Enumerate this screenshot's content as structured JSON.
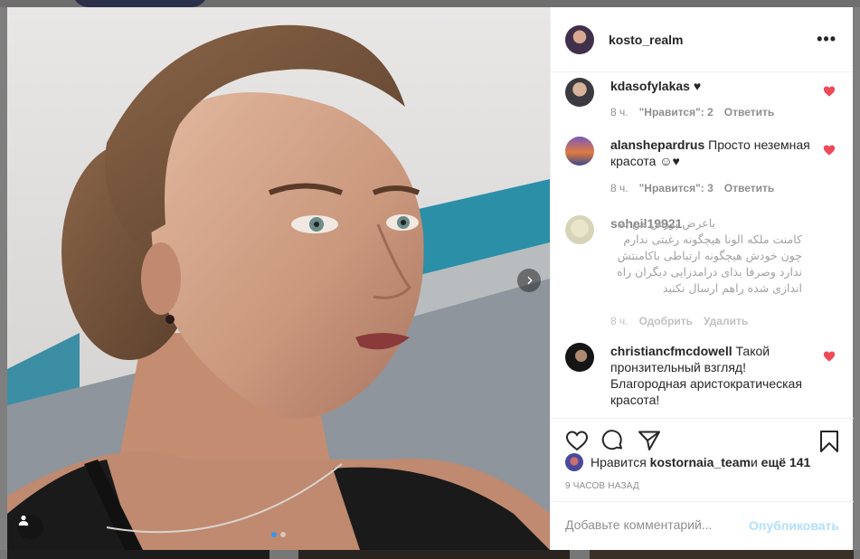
{
  "post": {
    "author": "kosto_realm",
    "more_icon": "more-horizontal-icon",
    "carousel_next_icon": "chevron-right-icon",
    "user_tag_icon": "user-tag-icon"
  },
  "comments": [
    {
      "username": "kdasofylakas",
      "text": " ♥",
      "time": "8 ч.",
      "likes": "\"Нравится\": 2",
      "reply": "Ответить"
    },
    {
      "username": "alanshepardrus",
      "text": " Просто неземная красота ☺♥",
      "time": "8 ч.",
      "likes": "\"Нравится\": 3",
      "reply": "Ответить"
    },
    {
      "username": "soheil19921",
      "text": "باعرض پوزش من به کامنت ملکه الونا هیچگونه رغبتی ندارم چون خودش هیچگونه ارتباطی باکامنتش ندارد وصرفا بذای درامدزایی دیگران راه اندازی شده راهم ارسال نکنید",
      "time": "8 ч.",
      "approve": "Одобрить",
      "delete": "Удалить"
    },
    {
      "username": "christiancfmcdowell",
      "text": " Такой пронзительный взгляд! Благородная аристократическая красота!"
    }
  ],
  "likes_line": {
    "prefix": "Нравится ",
    "user": "kostornaia_team",
    "middle": " и ",
    "others": "ещё 141"
  },
  "timestamp": "9 часов назад",
  "add_comment": {
    "placeholder": "Добавьте комментарий...",
    "publish": "Опубликовать"
  },
  "colors": {
    "heart": "#ed4956",
    "publish_disabled": "#b2dffc",
    "carousel_active": "#3897f0"
  }
}
